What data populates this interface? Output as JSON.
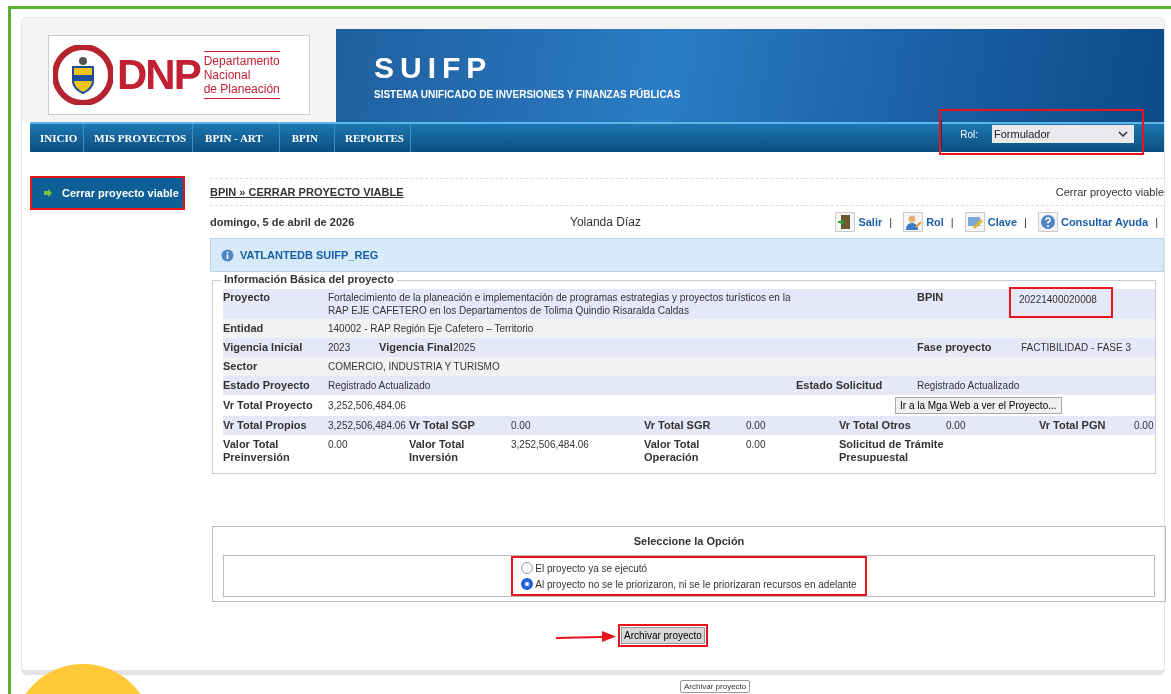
{
  "header": {
    "logo": {
      "acronym": "DNP",
      "lines": [
        "Departamento",
        "Nacional",
        "de Planeación"
      ]
    },
    "banner": {
      "title": "SUIFP",
      "subtitle": "SISTEMA UNIFICADO DE  INVERSIONES Y FINANZAS PÚBLICAS"
    }
  },
  "nav": {
    "items": [
      {
        "label": "INICIO"
      },
      {
        "label": "MIS PROYECTOS"
      },
      {
        "label": "BPIN - ART"
      },
      {
        "label": "BPIN"
      },
      {
        "label": "REPORTES"
      }
    ],
    "role": {
      "label": "Rol:",
      "value": "Formulador",
      "highlighted": true
    }
  },
  "sidebar": {
    "items": [
      {
        "label": "Cerrar proyecto viable",
        "highlighted": true
      }
    ]
  },
  "breadcrumb": "BPIN » CERRAR PROYECTO VIABLE",
  "page_title": "Cerrar proyecto viable",
  "date": "domingo, 5 de abril de 2026",
  "user": "Yolanda Díaz",
  "links": [
    {
      "kind": "exit",
      "label": "Salir",
      "separator": "|"
    },
    {
      "kind": "role",
      "label": "Rol",
      "separator": "|"
    },
    {
      "kind": "key",
      "label": "Clave",
      "separator": "|"
    },
    {
      "kind": "help",
      "label": "Consultar Ayuda",
      "separator": "|"
    }
  ],
  "info_banner": "VATLANTEDB SUIFP_REG",
  "project_info": {
    "legend": "Información Básica del proyecto",
    "lines": {
      "project": {
        "fields": [
          {
            "label": "Proyecto",
            "value": "Fortalecimiento de la planeación e implementación de programas estrategias y proyectos turísticos en la RAP EJE CAFETERO en los Departamentos de Tolima Quindio Risaralda Caldas"
          },
          {
            "label": "BPIN",
            "value": "20221400020008",
            "highlighted": true
          }
        ]
      },
      "entity": {
        "fields": [
          {
            "label": "Entidad",
            "value": "140002 - RAP Región Eje Cafetero – Territorio"
          }
        ]
      },
      "phase": {
        "fields": [
          {
            "label": "Vigencia Inicial",
            "value": "2023"
          },
          {
            "label": "Vigencia Final",
            "value": "2025"
          },
          {
            "label": "Fase proyecto",
            "value": "FACTIBILIDAD - FASE 3"
          }
        ]
      },
      "sector": {
        "fields": [
          {
            "label": "Sector",
            "value": "COMERCIO, INDUSTRIA Y TURISMO"
          }
        ]
      },
      "state": {
        "fields": [
          {
            "label": "Estado Proyecto",
            "value": "Registrado Actualizado"
          },
          {
            "label": "Estado Solicitud",
            "value": "Registrado Actualizado"
          }
        ]
      },
      "total": {
        "fields": [
          {
            "label": "Vr Total Proyecto",
            "value": "3,252,506,484.06"
          }
        ],
        "button": "Ir a la Mga Web a ver el Proyecto..."
      },
      "sources": {
        "fields": [
          {
            "label": "Vr Total Propios",
            "value": "3,252,506,484.06"
          },
          {
            "label": "Vr Total SGP",
            "value": "0.00"
          },
          {
            "label": "Vr Total SGR",
            "value": "0.00"
          },
          {
            "label": "Vr Total Otros",
            "value": "0.00"
          },
          {
            "label": "Vr Total PGN",
            "value": "0.00"
          }
        ]
      },
      "stages": {
        "fields": [
          {
            "label": "Valor Total Preinversión",
            "value": "0.00"
          },
          {
            "label": "Valor Total Inversión",
            "value": "3,252,506,484.06"
          },
          {
            "label": "Valor Total Operación",
            "value": "0.00"
          },
          {
            "label": "Solicitud de Trámite Presupuestal"
          }
        ]
      }
    }
  },
  "options": {
    "title": "Seleccione la Opción",
    "highlighted": true,
    "items": [
      {
        "label": "El proyecto ya se ejecutó",
        "selected": false
      },
      {
        "label": "Al proyecto no se le priorizaron, ni se le priorizaran recursos en adelante",
        "selected": true
      }
    ]
  },
  "archive_button": {
    "label": "Archivar proyecto",
    "highlighted": true,
    "pointer_arrow": true
  },
  "tooltip": "Archivar proyecto"
}
